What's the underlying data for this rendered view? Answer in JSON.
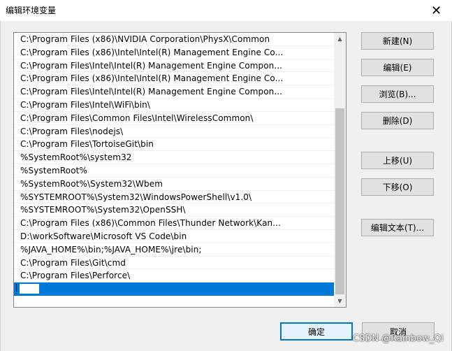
{
  "window": {
    "title": "编辑环境变量",
    "close_glyph": "✕"
  },
  "path_list": {
    "entries": [
      "C:\\Program Files (x86)\\NVIDIA Corporation\\PhysX\\Common",
      "C:\\Program Files (x86)\\Intel\\Intel(R) Management Engine Co...",
      "C:\\Program Files\\Intel\\Intel(R) Management Engine Compon...",
      "C:\\Program Files (x86)\\Intel\\Intel(R) Management Engine Co...",
      "C:\\Program Files\\Intel\\Intel(R) Management Engine Compon...",
      "C:\\Program Files\\Intel\\WiFi\\bin\\",
      "C:\\Program Files\\Common Files\\Intel\\WirelessCommon\\",
      "C:\\Program Files\\nodejs\\",
      "C:\\Program Files\\TortoiseGit\\bin",
      "%SystemRoot%\\system32",
      "%SystemRoot%",
      "%SystemRoot%\\System32\\Wbem",
      "%SYSTEMROOT%\\System32\\WindowsPowerShell\\v1.0\\",
      "%SYSTEMROOT%\\System32\\OpenSSH\\",
      "C:\\Program Files (x86)\\Common Files\\Thunder Network\\Kan...",
      "D:\\workSoftware\\Microsoft VS Code\\bin",
      "%JAVA_HOME%\\bin;%JAVA_HOME%\\jre\\bin;",
      "C:\\Program Files\\Git\\cmd",
      "C:\\Program Files\\Perforce\\"
    ],
    "editing_value": ""
  },
  "buttons": {
    "new": "新建(N)",
    "edit": "编辑(E)",
    "browse": "浏览(B)...",
    "delete": "删除(D)",
    "move_up": "上移(U)",
    "move_down": "下移(O)",
    "edit_text": "编辑文本(T)...",
    "ok": "确定",
    "cancel": "取消"
  },
  "scrollbar": {
    "up_glyph": "▲",
    "down_glyph": "▼"
  },
  "watermark": "CSDN @Rainbow_Qi",
  "colors": {
    "selection": "#0078d7",
    "default_button_border": "#0078d7"
  }
}
